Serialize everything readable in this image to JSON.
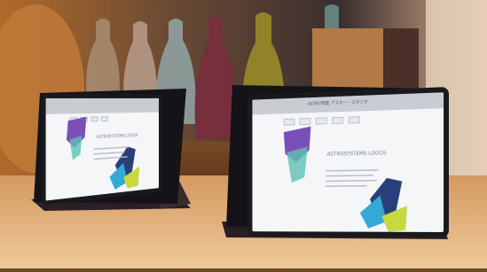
{
  "left_tablet": {
    "title": "ASTROSYSTEMS LOGOS",
    "nav": [
      "",
      "",
      "",
      ""
    ]
  },
  "right_tablet": {
    "topnote": "ASTRO特集 アスキー・スタジオ",
    "nav": [
      "",
      "",
      "",
      "",
      ""
    ],
    "title": "ASTROSYSTEMS LOGOS"
  },
  "colors": {
    "screen_bg": "#f4f6f8",
    "bezel": "#1a1a1e",
    "purple": "#7b4fb8",
    "teal": "#5fc2b6",
    "navy": "#2a3f7a",
    "cyan": "#34a9d6",
    "yellow_green": "#c7d93e",
    "wood": "#c98f55"
  }
}
